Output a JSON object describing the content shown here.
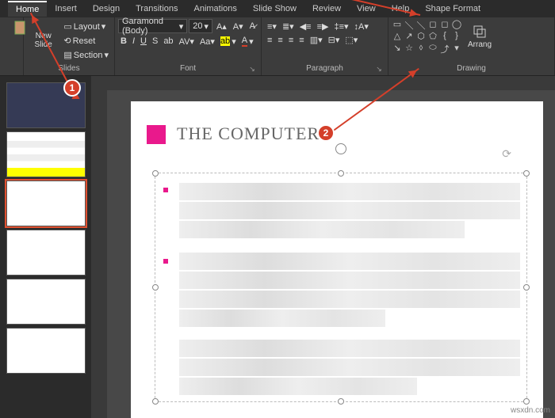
{
  "tabs": {
    "home": "Home",
    "insert": "Insert",
    "design": "Design",
    "transitions": "Transitions",
    "animations": "Animations",
    "slideshow": "Slide Show",
    "review": "Review",
    "view": "View",
    "help": "Help",
    "shapeformat": "Shape Format"
  },
  "slides_group": {
    "newslide": "New\nSlide",
    "layout": "Layout",
    "reset": "Reset",
    "section": "Section",
    "label": "Slides"
  },
  "font_group": {
    "name": "Garamond (Body)",
    "size": "20",
    "label": "Font"
  },
  "paragraph_group": {
    "label": "Paragraph"
  },
  "drawing_group": {
    "label": "Drawing",
    "arrange": "Arrang"
  },
  "slide": {
    "title": "THE COMPUTERS"
  },
  "annotations": {
    "n1": "1",
    "n2": "2"
  },
  "watermark": "wsxdn.com"
}
